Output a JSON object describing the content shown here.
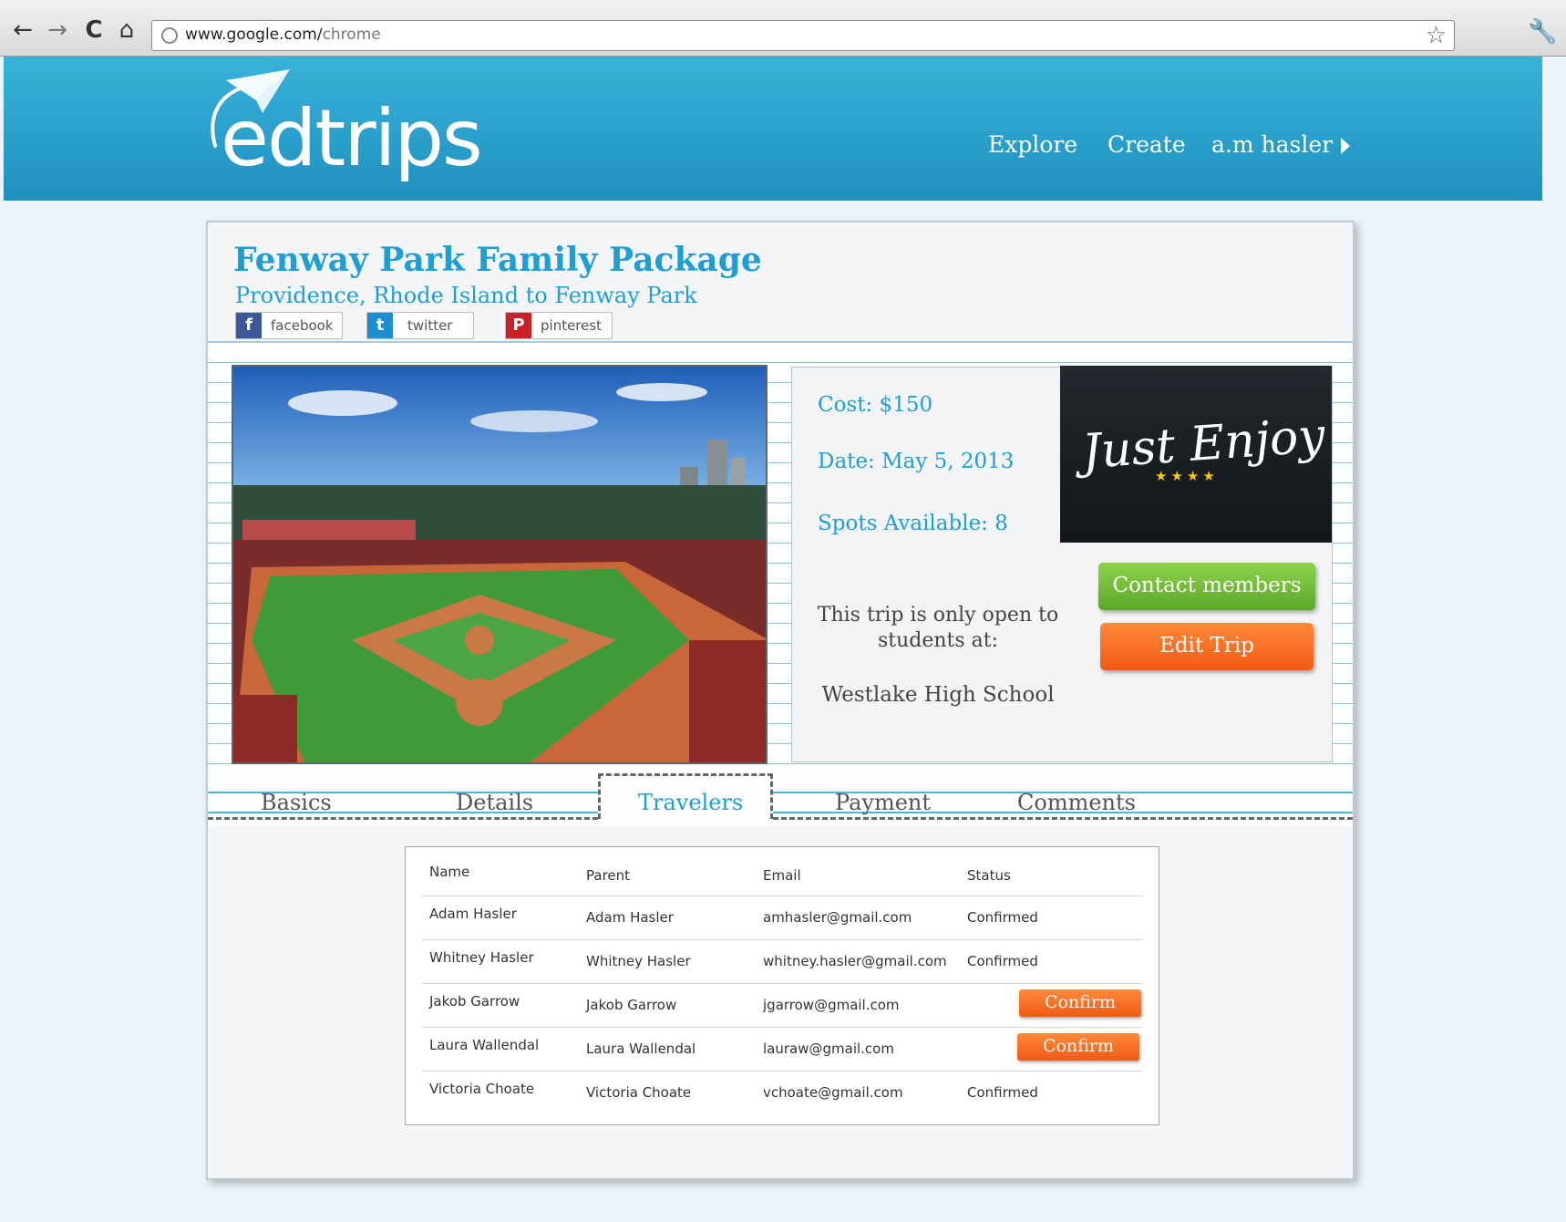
{
  "browser": {
    "back_icon": "←",
    "forward_icon": "→",
    "reload_icon": "C",
    "home_icon": "⌂",
    "url_host": "www.google.com/",
    "url_path": "chrome",
    "star_icon": "☆",
    "wrench_icon": "🔧"
  },
  "header": {
    "logo_text": "edtrips",
    "nav": [
      "Explore",
      "Create",
      "a.m hasler"
    ]
  },
  "trip": {
    "title": "Fenway Park Family Package",
    "subtitle": "Providence, Rhode Island to Fenway Park",
    "social": [
      {
        "icon": "f",
        "label": "facebook",
        "color": "#3b5998"
      },
      {
        "icon": "t",
        "label": "twitter",
        "color": "#1d8ed0"
      },
      {
        "icon": "P",
        "label": "pinterest",
        "color": "#cb2027"
      }
    ],
    "cost": "Cost: $150",
    "date": "Date: May 5, 2013",
    "spots": "Spots Available: 8",
    "open_text": "This trip is only open to students at:",
    "school": "Westlake High School",
    "banner_script": "Just Enjoy",
    "banner_stars": "★★★★",
    "contact_button": "Contact members",
    "edit_button": "Edit Trip"
  },
  "tabs": [
    "Basics",
    "Details",
    "Travelers",
    "Payment",
    "Comments"
  ],
  "travelers": {
    "headers": [
      "Name",
      "Parent",
      "Email",
      "Status"
    ],
    "rows": [
      {
        "name": "Adam Hasler",
        "parent": "Adam Hasler",
        "email": "amhasler@gmail.com",
        "status": "Confirmed",
        "needs_confirm": false
      },
      {
        "name": "Whitney Hasler",
        "parent": "Whitney Hasler",
        "email": "whitney.hasler@gmail.com",
        "status": "Confirmed",
        "needs_confirm": false
      },
      {
        "name": "Jakob Garrow",
        "parent": "Jakob Garrow",
        "email": "jgarrow@gmail.com",
        "status": "Confirm",
        "needs_confirm": true
      },
      {
        "name": "Laura Wallendal",
        "parent": "Laura Wallendal",
        "email": "lauraw@gmail.com",
        "status": "Confirm",
        "needs_confirm": true
      },
      {
        "name": "Victoria Choate",
        "parent": "Victoria Choate",
        "email": "vchoate@gmail.com",
        "status": "Confirmed",
        "needs_confirm": false
      }
    ]
  },
  "colors": {
    "brand_blue": "#1b9fd6",
    "header_blue": "#2aa3d0",
    "green": "#6dbb34",
    "orange": "#f6691f"
  }
}
